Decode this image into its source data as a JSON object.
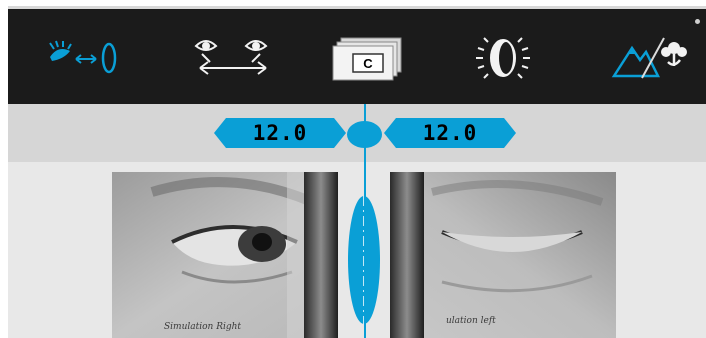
{
  "toolbar": {
    "items": [
      {
        "name": "eye-distance-icon"
      },
      {
        "name": "eyes-pd-icon"
      },
      {
        "name": "lens-cards-icon",
        "badge": "C"
      },
      {
        "name": "lens-light-icon"
      },
      {
        "name": "landscape-macro-icon"
      }
    ],
    "accent": "#0a9fd6",
    "background": "#1b1b1b"
  },
  "pd": {
    "right": "12.0",
    "left": "12.0"
  },
  "simulation": {
    "caption_right": "Simulation Right",
    "caption_left": "ulation left"
  },
  "colors": {
    "accent": "#0a9fd6",
    "panel": "#d6d6d6"
  }
}
